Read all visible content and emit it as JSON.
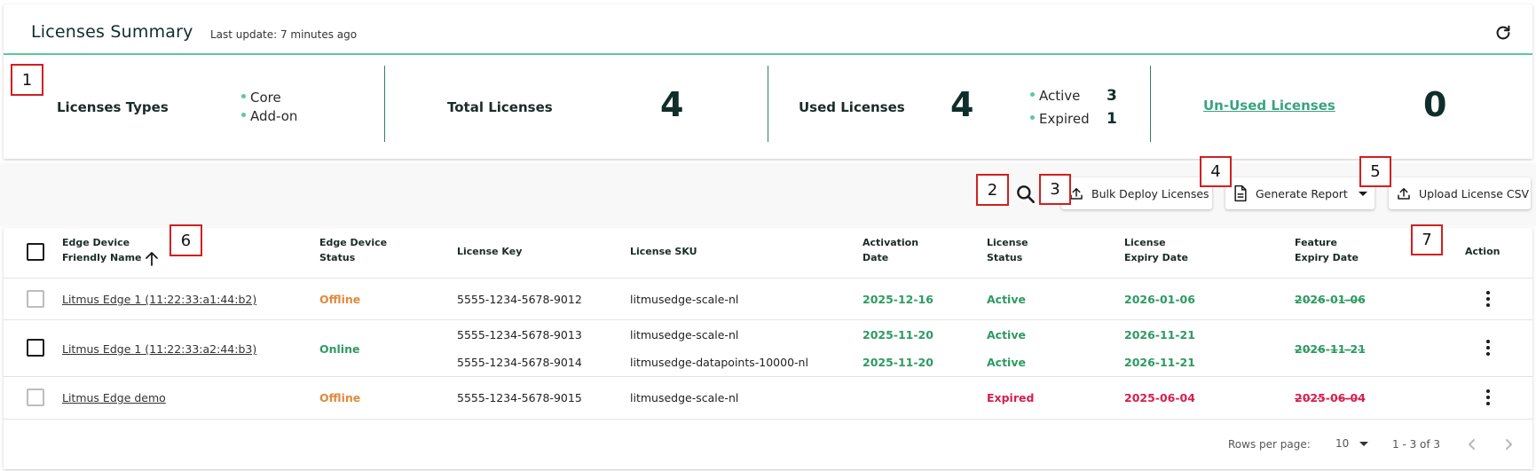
{
  "summary": {
    "title": "Licenses Summary",
    "last_update": "Last update: 7 minutes ago",
    "types_label": "Licenses Types",
    "types": [
      "Core",
      "Add-on"
    ],
    "total_label": "Total Licenses",
    "total_value": "4",
    "used_label": "Used Licenses",
    "used_value": "4",
    "used_breakdown": [
      {
        "label": "Active",
        "value": "3"
      },
      {
        "label": "Expired",
        "value": "1"
      }
    ],
    "unused_label": "Un-Used Licenses",
    "unused_value": "0"
  },
  "toolbar": {
    "bulk_deploy": "Bulk Deploy Licenses",
    "generate_report": "Generate Report",
    "upload_csv": "Upload License CSV"
  },
  "table": {
    "headers": {
      "device_name": [
        "Edge Device",
        "Friendly Name"
      ],
      "device_status": [
        "Edge Device",
        "Status"
      ],
      "license_key": [
        "License Key"
      ],
      "license_sku": [
        "License SKU"
      ],
      "activation_date": [
        "Activation",
        "Date"
      ],
      "license_status": [
        "License",
        "Status"
      ],
      "license_expiry": [
        "License",
        "Expiry Date"
      ],
      "feature_expiry": [
        "Feature",
        "Expiry Date"
      ],
      "action": [
        "Action"
      ]
    },
    "rows": [
      {
        "device": "Litmus Edge 1 (11:22:33:a1:44:b2)",
        "status": "Offline",
        "licenses": [
          {
            "key": "5555-1234-5678-9012",
            "sku": "litmusedge-scale-nl",
            "activation": "2025-12-16",
            "status": "Active",
            "expiry": "2026-01-06"
          }
        ],
        "feature_expiry": "2026-01-06"
      },
      {
        "device": "Litmus Edge 1 (11:22:33:a2:44:b3)",
        "status": "Online",
        "licenses": [
          {
            "key": "5555-1234-5678-9013",
            "sku": "litmusedge-scale-nl",
            "activation": "2025-11-20",
            "status": "Active",
            "expiry": "2026-11-21"
          },
          {
            "key": "5555-1234-5678-9014",
            "sku": "litmusedge-datapoints-10000-nl",
            "activation": "2025-11-20",
            "status": "Active",
            "expiry": "2026-11-21"
          }
        ],
        "feature_expiry": "2026-11-21"
      },
      {
        "device": "Litmus Edge demo",
        "status": "Offline",
        "licenses": [
          {
            "key": "5555-1234-5678-9015",
            "sku": "litmusedge-scale-nl",
            "activation": "",
            "status": "Expired",
            "expiry": "2025-06-04"
          }
        ],
        "feature_expiry": "2025-06-04"
      }
    ]
  },
  "pagination": {
    "rows_per_page_label": "Rows per page:",
    "rows_per_page": "10",
    "range": "1 - 3 of 3"
  },
  "annotations": [
    "1",
    "2",
    "3",
    "4",
    "5",
    "6",
    "7"
  ],
  "colors": {
    "accent": "#5cc6a0",
    "link_green": "#3aa37f",
    "success": "#2e9a62",
    "offline": "#e08a3c",
    "expired": "#d6204e"
  }
}
